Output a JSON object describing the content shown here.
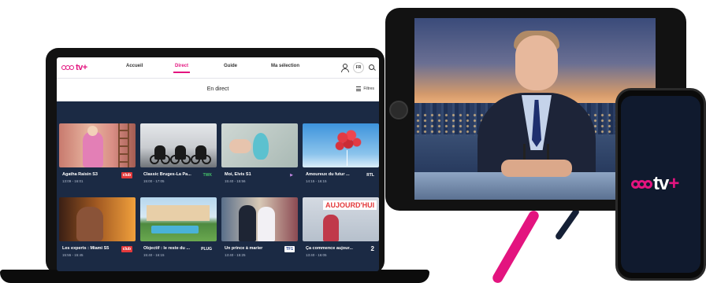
{
  "brand": {
    "logo_text": "tv",
    "logo_plus": "+"
  },
  "colors": {
    "accent": "#e3147f",
    "navy": "#1b2a44",
    "white": "#ffffff"
  },
  "laptop": {
    "nav": {
      "items": [
        {
          "label": "Accueil",
          "active": false
        },
        {
          "label": "Direct",
          "active": true
        },
        {
          "label": "Guide",
          "active": false
        },
        {
          "label": "Ma sélection",
          "active": false
        }
      ],
      "language": "FR",
      "user_icon": "user-icon",
      "search_icon": "search-icon"
    },
    "subheader": {
      "title": "En direct",
      "filter_label": "Filtres",
      "filter_icon": "sliders-icon"
    },
    "cards": [
      {
        "title": "Agatha Raisin S3",
        "time": "13:09 - 16:01",
        "channel": "club"
      },
      {
        "title": "Classic Bruges-La Pa...",
        "time": "15:00 - 17:05",
        "channel": "TWK"
      },
      {
        "title": "Moi, Elvis S1",
        "time": "15:40 - 15:56",
        "channel": "▶"
      },
      {
        "title": "Amoureux du futur ...",
        "time": "14:15 - 16:15",
        "channel": "RTL"
      },
      {
        "title": "Les experts : Miami S5",
        "time": "15:55 - 15:45",
        "channel": "club"
      },
      {
        "title": "Objectif : le reste du ...",
        "time": "15:40 - 16:15",
        "channel": "PLUG"
      },
      {
        "title": "Un prince à marier",
        "time": "13:40 - 15:25",
        "channel": "TF1"
      },
      {
        "title": "Ça commence aujour...",
        "time": "13:40 - 16:05",
        "channel": "2"
      }
    ]
  },
  "phone": {
    "logo_text": "tv",
    "logo_plus": "+"
  }
}
